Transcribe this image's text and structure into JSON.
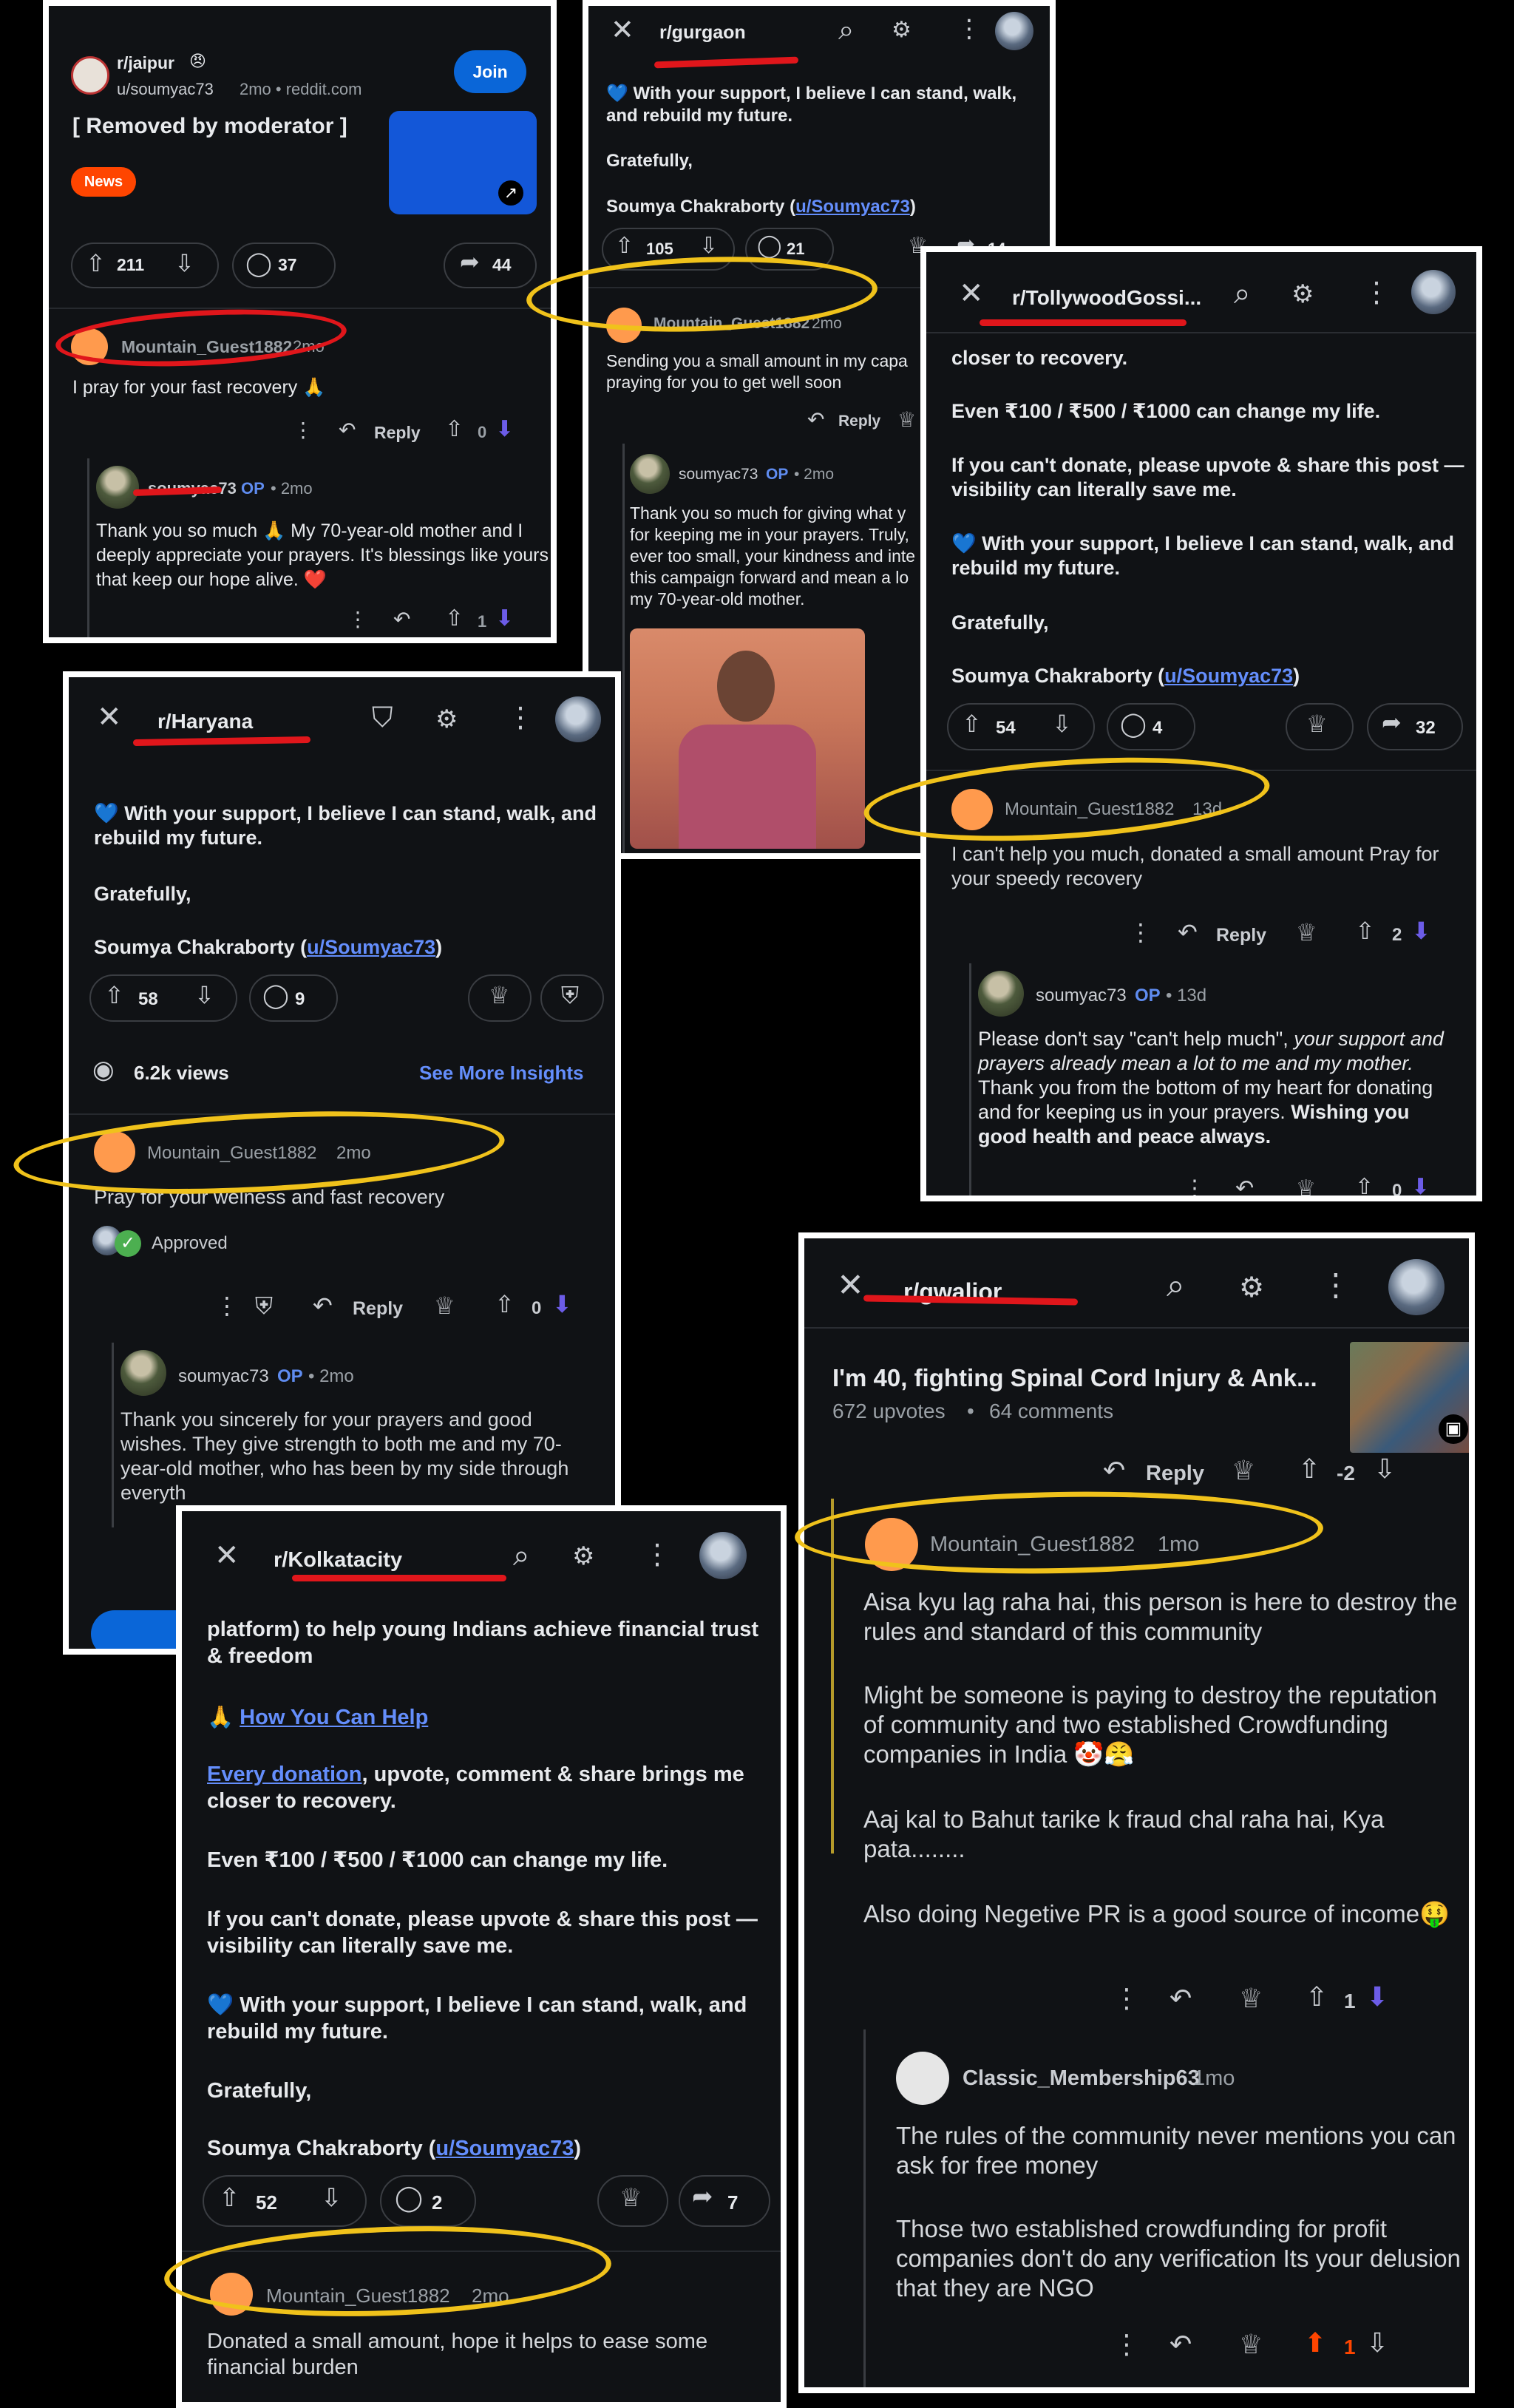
{
  "p1": {
    "sub": "r/jaipur",
    "author": "u/soumyac73",
    "meta": "2mo • reddit.com",
    "join": "Join",
    "title": "[ Removed by moderator ]",
    "flair": "News",
    "up": "211",
    "comments": "37",
    "share": "44",
    "c1_user": "Mountain_Guest1882",
    "c1_time": "2mo",
    "c1_text": "I pray for your fast recovery 🙏",
    "reply": "Reply",
    "c1_votes": "0",
    "c2_user": "soumyac73",
    "op": "OP",
    "c2_time": "• 2mo",
    "c2_text": "Thank you so much 🙏 My 70-year-old mother and I deeply appreciate your prayers. It's blessings like yours that keep our hope alive. ❤️",
    "c2_votes": "1"
  },
  "p2": {
    "sub": "r/gurgaon",
    "body1": "💙 With your support, I believe I can stand, walk, and rebuild my future.",
    "body2": "Gratefully,",
    "sig_name": "Soumya Chakraborty (",
    "sig_link": "u/Soumyac73",
    "sig_end": ")",
    "up": "105",
    "comments": "21",
    "share": "14",
    "c1_user": "Mountain_Guest1882",
    "c1_time": "2mo",
    "c1_text": "Sending you a small amount in my capa praying for you to get well soon",
    "reply": "Reply",
    "c2_user": "soumyac73",
    "op": "OP",
    "c2_time": "• 2mo",
    "c2_text": "Thank you so much for giving what y for keeping me in your prayers. Truly, ever too small, your kindness and inte this campaign forward and mean a lo my 70-year-old mother."
  },
  "p3": {
    "sub": "r/TollywoodGossi...",
    "l1": "closer to recovery.",
    "l2": "Even ₹100 / ₹500 / ₹1000 can change my life.",
    "l3": "If you can't donate, please upvote & share this post — visibility can literally save me.",
    "l4": "💙 With your support, I believe I can stand, walk, and rebuild my future.",
    "l5": "Gratefully,",
    "sig_name": "Soumya Chakraborty (",
    "sig_link": "u/Soumyac73",
    "sig_end": ")",
    "up": "54",
    "comments": "4",
    "share": "32",
    "c1_user": "Mountain_Guest1882",
    "c1_time": "13d",
    "c1_text": "I can't help you much, donated a small amount Pray for your speedy recovery",
    "reply": "Reply",
    "c1_votes": "2",
    "c2_user": "soumyac73",
    "op": "OP",
    "c2_time": "• 13d",
    "c2_a": "Please don't say \"can't help much\",",
    "c2_b": " your support and prayers already mean a lot to me and my mother.",
    "c2_c": " Thank you from the bottom of my heart for donating and for keeping us in your prayers.",
    "c2_d": "Wishing you good health and peace always.",
    "c2_votes": "0"
  },
  "p4": {
    "sub": "r/Haryana",
    "l1": "💙 With your support, I believe I can stand, walk, and rebuild my future.",
    "l2": "Gratefully,",
    "sig_name": "Soumya Chakraborty (",
    "sig_link": "u/Soumyac73",
    "sig_end": ")",
    "up": "58",
    "comments": "9",
    "views": "6.2k views",
    "insights": "See More Insights",
    "c1_user": "Mountain_Guest1882",
    "c1_time": "2mo",
    "c1_text": "Pray for your welness and fast recovery",
    "approved": "Approved",
    "reply": "Reply",
    "c1_votes": "0",
    "c2_user": "soumyac73",
    "op": "OP",
    "c2_time": "• 2mo",
    "c2_text": "Thank you sincerely for your prayers and good wishes. They give strength to both me and my 70-year-old mother, who has been by my side through everyth"
  },
  "p5": {
    "sub": "r/Kolkatacity",
    "l0": "platform) to help young Indians achieve financial trust & freedom",
    "help_icon": "🙏",
    "help": "How You Can Help",
    "l2_link": "Every donation",
    "l2_rest": ", upvote, comment & share brings me closer to recovery.",
    "l3": "Even ₹100 / ₹500 / ₹1000 can change my life.",
    "l4": "If you can't donate, please upvote & share this post — visibility can literally save me.",
    "l5": "💙 With your support, I believe I can stand, walk, and rebuild my future.",
    "l6": "Gratefully,",
    "sig_name": "Soumya Chakraborty (",
    "sig_link": "u/Soumyac73",
    "sig_end": ")",
    "up": "52",
    "comments": "2",
    "share": "7",
    "c1_user": "Mountain_Guest1882",
    "c1_time": "2mo",
    "c1_text": "Donated a small amount, hope it helps to ease some financial burden"
  },
  "p6": {
    "sub": "r/gwalior",
    "title": "I'm 40, fighting Spinal Cord Injury & Ank...",
    "stats1": "672 upvotes",
    "stats_sep": "•",
    "stats2": "64 comments",
    "reply": "Reply",
    "top_votes": "-2",
    "c1_user": "Mountain_Guest1882",
    "c1_time": "1mo",
    "c1_p1": "Aisa kyu lag raha hai, this person is here to destroy the rules and standard of this community",
    "c1_p2": "Might be someone is paying to destroy the reputation of community and two established Crowdfunding companies in India 🤡😤",
    "c1_p3": "Aaj kal to Bahut tarike k fraud chal raha hai, Kya pata........",
    "c1_p4": "Also doing Negetive PR is a good source of income🤑",
    "c1_votes": "1",
    "c2_user": "Classic_Membership63",
    "c2_time": "1mo",
    "c2_p1": "The rules of the community never mentions you can ask for free money",
    "c2_p2": "Those two established crowdfunding for profit companies don't do any verification Its your delusion that they are NGO",
    "c2_votes": "1"
  },
  "colors": {
    "annotation_red": "#e0161b",
    "annotation_yellow": "#f0c21b",
    "accent_blue": "#648efc",
    "join_blue": "#0a66d8",
    "upvote_orange": "#ff4500"
  },
  "icons": [
    "close-icon",
    "search-icon",
    "filter-icon",
    "more-icon",
    "upvote-icon",
    "downvote-icon",
    "comment-icon",
    "share-icon",
    "award-icon",
    "reply-icon",
    "eye-icon",
    "shield-icon",
    "mod-icon"
  ]
}
